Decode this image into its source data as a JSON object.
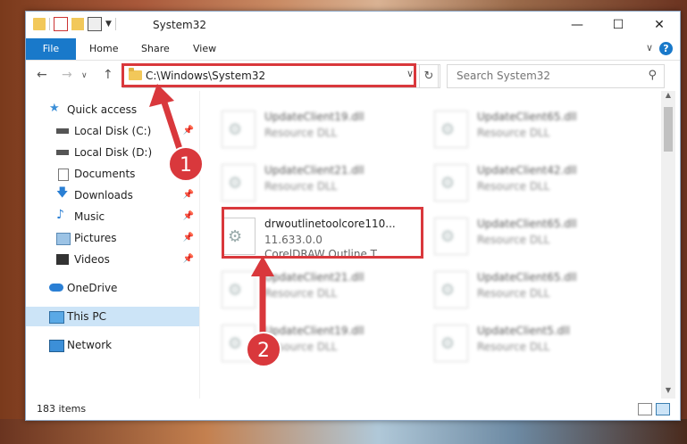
{
  "window": {
    "title": "System32"
  },
  "ribbon": {
    "file": "File",
    "home": "Home",
    "share": "Share",
    "view": "View",
    "help": "?"
  },
  "navbar": {
    "address": "C:\\Windows\\System32",
    "search_placeholder": "Search System32"
  },
  "nav_pane": {
    "items": [
      {
        "label": "Quick access"
      },
      {
        "label": "Local Disk (C:)"
      },
      {
        "label": "Local Disk (D:)"
      },
      {
        "label": "Documents"
      },
      {
        "label": "Downloads"
      },
      {
        "label": "Music"
      },
      {
        "label": "Pictures"
      },
      {
        "label": "Videos"
      },
      {
        "label": "OneDrive"
      },
      {
        "label": "This PC"
      },
      {
        "label": "Network"
      }
    ]
  },
  "files": {
    "left": [
      {
        "name": "UpdateClient19.dll",
        "type": "Resource DLL"
      },
      {
        "name": "UpdateClient21.dll",
        "type": "Resource DLL"
      },
      {
        "name": "UpdateClient21.dll",
        "type": "Resource DLL"
      },
      {
        "name": "UpdateClient19.dll",
        "type": "Resource DLL"
      }
    ],
    "right": [
      {
        "name": "UpdateClient65.dll",
        "type": "Resource DLL"
      },
      {
        "name": "UpdateClient42.dll",
        "type": "Resource DLL"
      },
      {
        "name": "UpdateClient65.dll",
        "type": "Resource DLL"
      },
      {
        "name": "UpdateClient65.dll",
        "type": "Resource DLL"
      },
      {
        "name": "UpdateClient5.dll",
        "type": "Resource DLL"
      }
    ],
    "highlighted": {
      "name": "drwoutlinetoolcore110...",
      "version": "11.633.0.0",
      "description": "CorelDRAW Outline T..."
    }
  },
  "status": {
    "count": "183 items"
  },
  "annotations": {
    "badge1": "1",
    "badge2": "2",
    "color": "#d9383c"
  }
}
